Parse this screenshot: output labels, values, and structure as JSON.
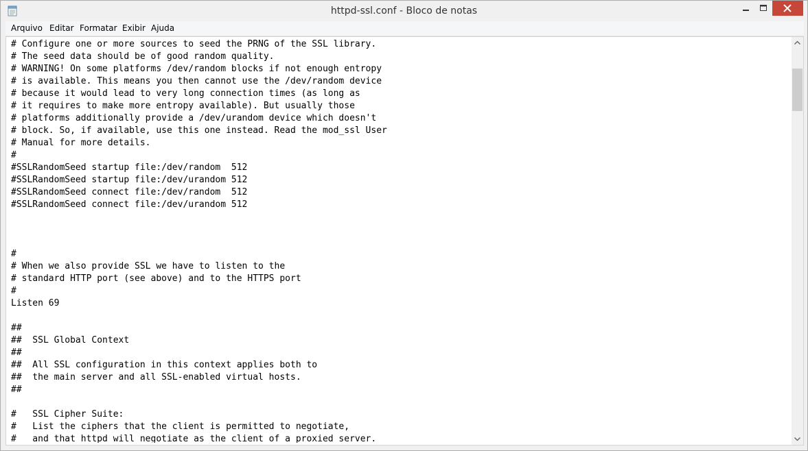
{
  "window": {
    "title": "httpd-ssl.conf - Bloco de notas",
    "icon": "notepad-icon"
  },
  "controls": {
    "minimize_icon": "minimize-icon",
    "maximize_icon": "maximize-icon",
    "close_icon": "close-icon"
  },
  "menu": {
    "items": [
      "Arquivo",
      "Editar",
      "Formatar",
      "Exibir",
      "Ajuda"
    ]
  },
  "editor": {
    "content": "# Configure one or more sources to seed the PRNG of the SSL library.\n# The seed data should be of good random quality.\n# WARNING! On some platforms /dev/random blocks if not enough entropy\n# is available. This means you then cannot use the /dev/random device\n# because it would lead to very long connection times (as long as\n# it requires to make more entropy available). But usually those\n# platforms additionally provide a /dev/urandom device which doesn't\n# block. So, if available, use this one instead. Read the mod_ssl User\n# Manual for more details.\n#\n#SSLRandomSeed startup file:/dev/random  512\n#SSLRandomSeed startup file:/dev/urandom 512\n#SSLRandomSeed connect file:/dev/random  512\n#SSLRandomSeed connect file:/dev/urandom 512\n\n\n\n#\n# When we also provide SSL we have to listen to the \n# standard HTTP port (see above) and to the HTTPS port\n#\nListen 69\n\n##\n##  SSL Global Context\n##\n##  All SSL configuration in this context applies both to\n##  the main server and all SSL-enabled virtual hosts.\n##\n\n#   SSL Cipher Suite:\n#   List the ciphers that the client is permitted to negotiate,\n#   and that httpd will negotiate as the client of a proxied server."
  },
  "colors": {
    "close_button": "#c7463a",
    "chrome": "#f0f0f0",
    "editor_bg": "#ffffff"
  }
}
